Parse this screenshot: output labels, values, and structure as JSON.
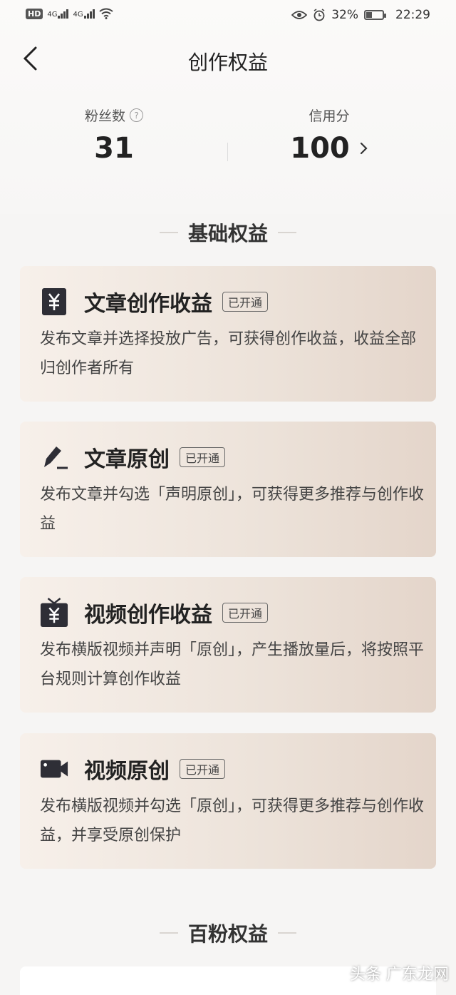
{
  "status_bar": {
    "hd": "HD",
    "sim": "2",
    "net1": "4G",
    "net2": "4G",
    "battery": "32%",
    "time": "22:29"
  },
  "nav": {
    "title": "创作权益"
  },
  "stats": {
    "fans_label": "粉丝数",
    "fans_value": "31",
    "credit_label": "信用分",
    "credit_value": "100"
  },
  "sections": {
    "basic_title": "基础权益",
    "hundred_title": "百粉权益"
  },
  "cards": [
    {
      "title": "文章创作收益",
      "badge": "已开通",
      "desc": "发布文章并选择投放广告，可获得创作收益，收益全部归创作者所有",
      "icon": "yuan-icon"
    },
    {
      "title": "文章原创",
      "badge": "已开通",
      "desc": "发布文章并勾选「声明原创」，可获得更多推荐与创作收益",
      "icon": "pen-icon"
    },
    {
      "title": "视频创作收益",
      "badge": "已开通",
      "desc": "发布横版视频并声明「原创」，产生播放量后，将按照平台规则计算创作收益",
      "icon": "tv-yuan-icon"
    },
    {
      "title": "视频原创",
      "badge": "已开通",
      "desc": "发布横版视频并勾选「原创」，可获得更多推荐与创作收益，并享受原创保护",
      "icon": "video-camera-icon"
    }
  ],
  "watermark": "头条 广东龙网"
}
